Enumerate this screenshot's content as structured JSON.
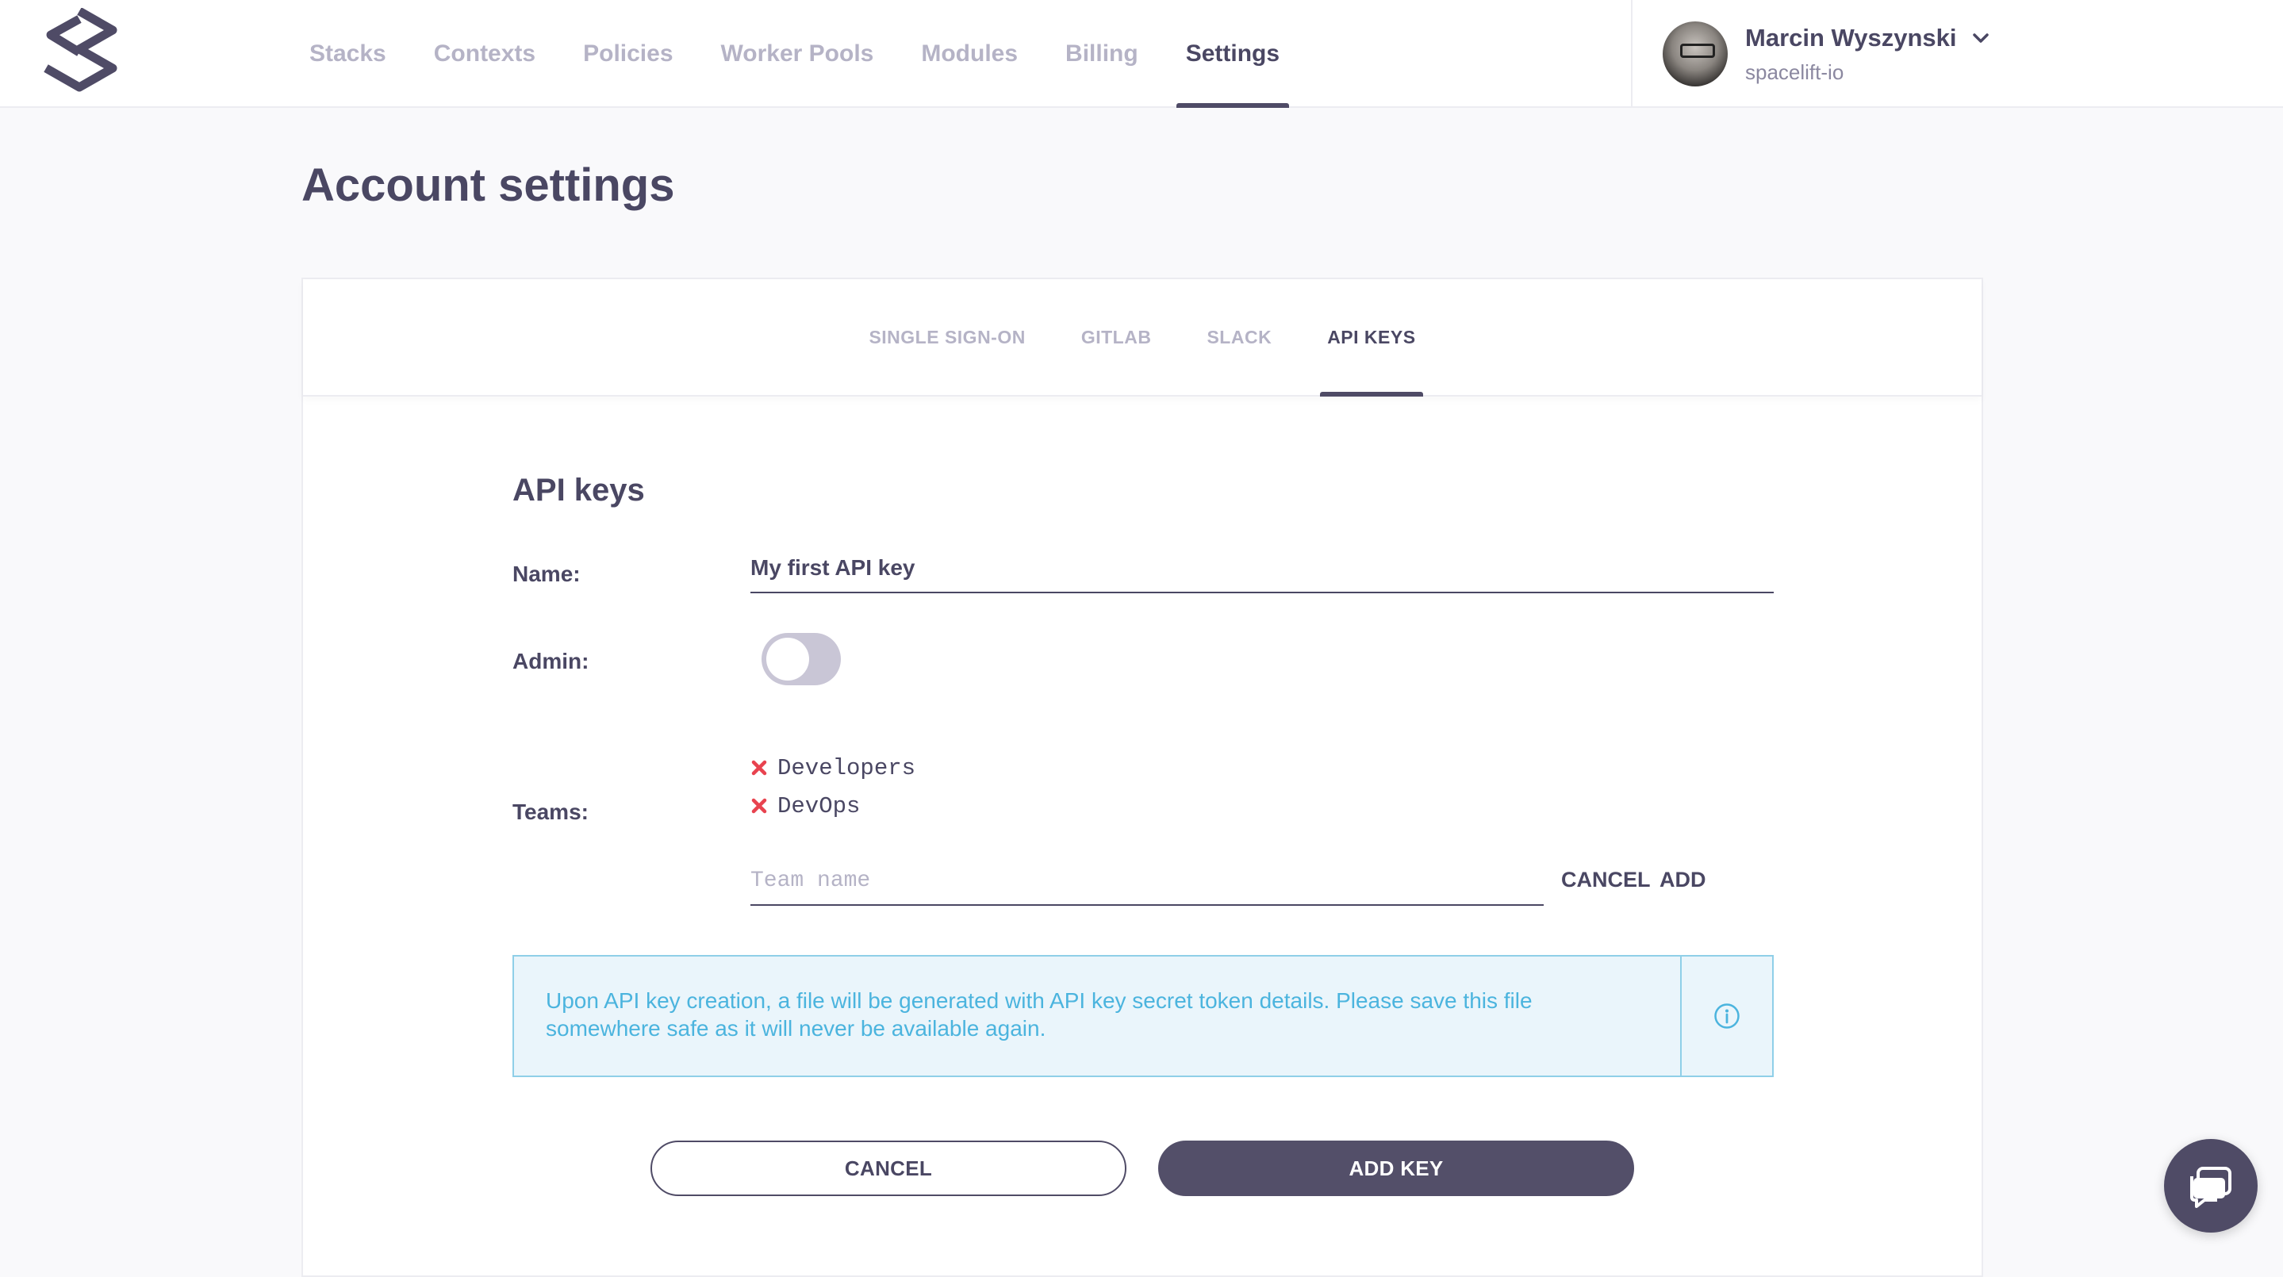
{
  "nav": {
    "items": [
      {
        "label": "Stacks",
        "active": false
      },
      {
        "label": "Contexts",
        "active": false
      },
      {
        "label": "Policies",
        "active": false
      },
      {
        "label": "Worker Pools",
        "active": false
      },
      {
        "label": "Modules",
        "active": false
      },
      {
        "label": "Billing",
        "active": false
      },
      {
        "label": "Settings",
        "active": true
      }
    ]
  },
  "user": {
    "name": "Marcin Wyszynski",
    "org": "spacelift-io"
  },
  "page": {
    "title": "Account settings"
  },
  "tabs": [
    {
      "label": "SINGLE SIGN-ON",
      "active": false
    },
    {
      "label": "GITLAB",
      "active": false
    },
    {
      "label": "SLACK",
      "active": false
    },
    {
      "label": "API KEYS",
      "active": true
    }
  ],
  "form": {
    "section_title": "API keys",
    "name_label": "Name:",
    "name_value": "My first API key",
    "admin_label": "Admin:",
    "admin_enabled": false,
    "teams_label": "Teams:",
    "teams": [
      "Developers",
      "DevOps"
    ],
    "team_placeholder": "Team name",
    "team_cancel": "CANCEL",
    "team_add": "ADD",
    "info_text": "Upon API key creation, a file will be generated with API key secret token details. Please save this file somewhere safe as it will never be available again.",
    "cancel_button": "CANCEL",
    "add_button": "ADD KEY"
  },
  "colors": {
    "primary": "#4f4b66",
    "muted": "#b5b3c6",
    "info": "#4bb4de",
    "remove": "#e8434f"
  }
}
